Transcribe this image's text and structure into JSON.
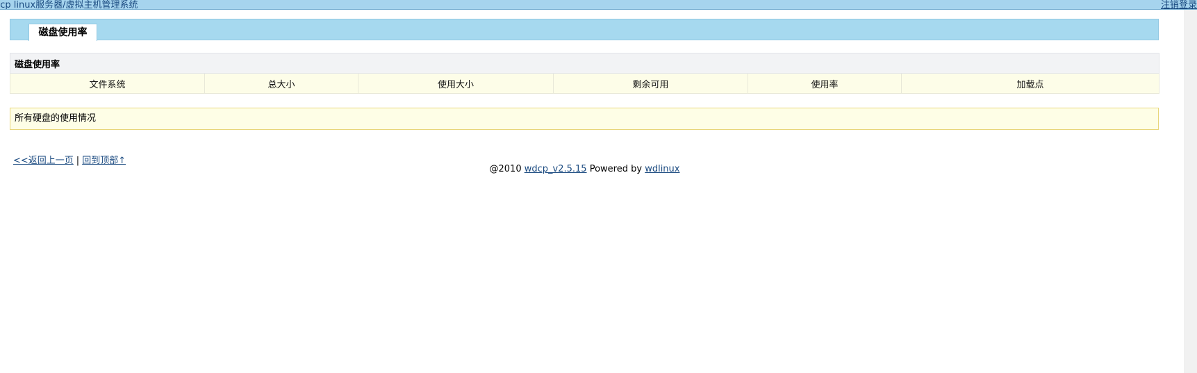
{
  "header": {
    "title": "dcp linux服务器/虚拟主机管理系统",
    "logout_label": "注销登录"
  },
  "tabs": [
    {
      "label": "磁盘使用率",
      "active": true
    }
  ],
  "table": {
    "caption": "磁盘使用率",
    "columns": [
      "文件系统",
      "总大小",
      "使用大小",
      "剩余可用",
      "使用率",
      "加载点"
    ]
  },
  "notice": {
    "text": "所有硬盘的使用情况"
  },
  "nav": {
    "back_label": "<<返回上一页",
    "separator": "|",
    "top_label": "回到顶部↑"
  },
  "footer": {
    "prefix": "@2010",
    "version_link": "wdcp_v2.5.15",
    "powered_by": "Powered by",
    "vendor_link": "wdlinux"
  },
  "colors": {
    "header_bg": "#a6d4ee",
    "tabbar_bg": "#a6d9ef",
    "table_head_bg": "#fdfde8",
    "notice_bg": "#fefee6",
    "notice_border": "#e8d67a",
    "link": "#1a4a80"
  }
}
